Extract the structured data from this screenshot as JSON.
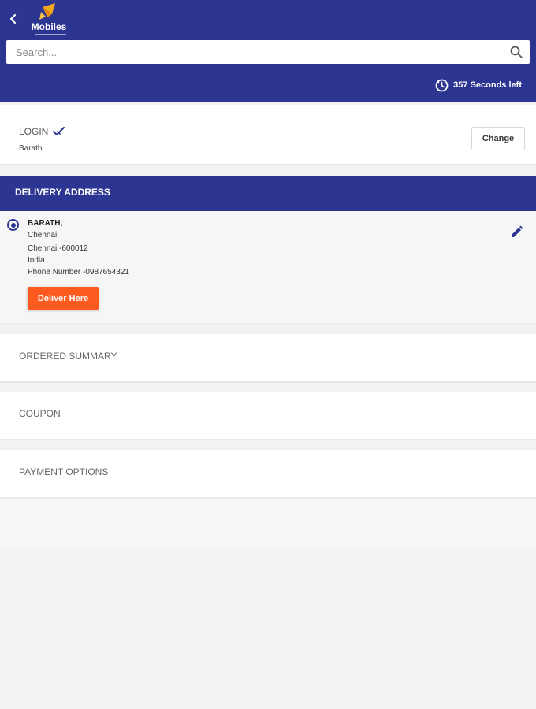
{
  "header": {
    "logo_text": "Mobiles",
    "search_placeholder": "Search...",
    "timer_text": "357 Seconds left",
    "brand_color": "#2c3592"
  },
  "login": {
    "title": "LOGIN",
    "user_name": "Barath",
    "change_label": "Change"
  },
  "delivery": {
    "title": "DELIVERY ADDRESS",
    "address": {
      "name": "BARATH,",
      "city": "Chennai",
      "pin_line": "Chennai -600012",
      "country": "India",
      "phone": "Phone Number -0987654321"
    },
    "deliver_button": "Deliver Here",
    "accent_color": "#fc5a1e"
  },
  "sections": {
    "ordered_summary": "ORDERED SUMMARY",
    "coupon": "COUPON",
    "payment_options": "PAYMENT OPTIONS"
  },
  "icons": [
    "back-arrow-icon",
    "logo-icon",
    "search-icon",
    "timer-icon",
    "check-icon",
    "radio-icon",
    "edit-pencil-icon"
  ]
}
